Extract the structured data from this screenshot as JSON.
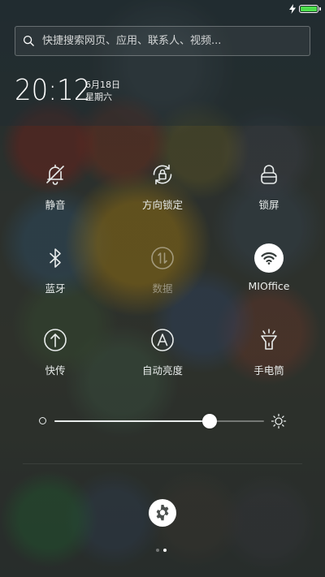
{
  "status_bar": {
    "battery_level": 1.0,
    "charging": true,
    "battery_color": "#4cdd4c"
  },
  "search": {
    "placeholder": "快捷搜索网页、应用、联系人、视频..."
  },
  "clock": {
    "time": "20:12",
    "date": "6月18日",
    "weekday": "星期六"
  },
  "toggles": [
    {
      "label": "静音",
      "icon": "bell-off-icon",
      "active": false,
      "enabled": true
    },
    {
      "label": "方向锁定",
      "icon": "rotation-lock-icon",
      "active": false,
      "enabled": true
    },
    {
      "label": "锁屏",
      "icon": "lock-icon",
      "active": false,
      "enabled": true
    },
    {
      "label": "蓝牙",
      "icon": "bluetooth-icon",
      "active": false,
      "enabled": true
    },
    {
      "label": "数据",
      "icon": "mobile-data-icon",
      "active": false,
      "enabled": false
    },
    {
      "label": "MIOffice",
      "icon": "wifi-icon",
      "active": true,
      "enabled": true
    },
    {
      "label": "快传",
      "icon": "transfer-icon",
      "active": false,
      "enabled": true
    },
    {
      "label": "自动亮度",
      "icon": "auto-brightness-icon",
      "active": false,
      "enabled": true
    },
    {
      "label": "手电筒",
      "icon": "flashlight-icon",
      "active": false,
      "enabled": true
    }
  ],
  "brightness": {
    "level": 0.74
  },
  "settings": {
    "icon": "gear-icon"
  },
  "pager": {
    "pages": 2,
    "current": 2
  }
}
